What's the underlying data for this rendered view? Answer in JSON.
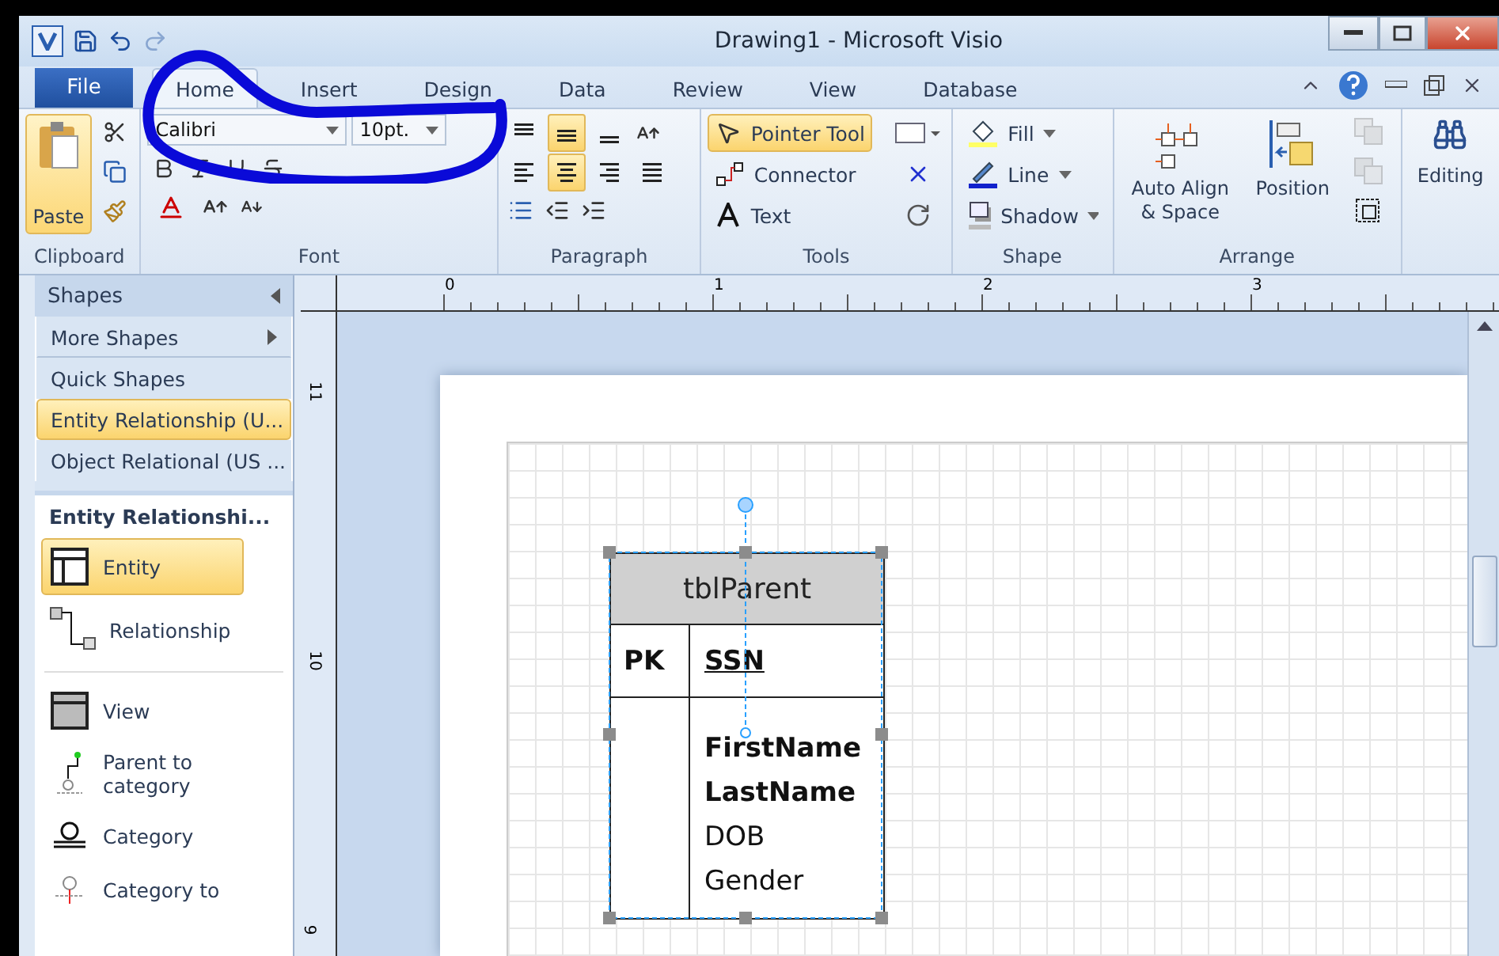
{
  "window": {
    "title": "Drawing1  -  Microsoft Visio"
  },
  "file_tab": "File",
  "tabs": [
    {
      "label": "Home",
      "selected": true
    },
    {
      "label": "Insert",
      "selected": false
    },
    {
      "label": "Design",
      "selected": false
    },
    {
      "label": "Data",
      "selected": false
    },
    {
      "label": "Review",
      "selected": false
    },
    {
      "label": "View",
      "selected": false
    },
    {
      "label": "Database",
      "selected": false
    }
  ],
  "ribbon": {
    "clipboard": {
      "paste": "Paste",
      "label": "Clipboard"
    },
    "font": {
      "font_name": "Calibri",
      "font_size": "10pt.",
      "label": "Font"
    },
    "paragraph": {
      "label": "Paragraph",
      "vertical_align": [
        {
          "selected": false
        },
        {
          "selected": true
        },
        {
          "selected": false
        }
      ],
      "horizontal_align": [
        {
          "selected": false
        },
        {
          "selected": true
        },
        {
          "selected": false
        },
        {
          "selected": false
        }
      ]
    },
    "tools": {
      "label": "Tools",
      "items": [
        {
          "kind": "pointer",
          "label": "Pointer Tool",
          "selected": true
        },
        {
          "kind": "connector",
          "label": "Connector",
          "selected": false
        },
        {
          "kind": "text",
          "label": "Text",
          "selected": false
        }
      ]
    },
    "shape": {
      "label": "Shape",
      "items": [
        {
          "kind": "fill",
          "label": "Fill"
        },
        {
          "kind": "line",
          "label": "Line"
        },
        {
          "kind": "shadow",
          "label": "Shadow"
        }
      ]
    },
    "arrange": {
      "label": "Arrange",
      "auto_align": "Auto Align & Space",
      "position": "Position"
    },
    "editing": {
      "label": "Editing"
    }
  },
  "shapes_panel": {
    "title": "Shapes",
    "items": [
      {
        "kind": "menu",
        "label": "More Shapes",
        "selected": false
      },
      {
        "kind": "stencil",
        "label": "Quick Shapes",
        "selected": false
      },
      {
        "kind": "stencil",
        "label": "Entity Relationship (U...",
        "selected": true
      },
      {
        "kind": "stencil",
        "label": "Object Relational (US ...",
        "selected": false
      }
    ],
    "stencil_title": "Entity Relationshi...",
    "masters": [
      {
        "kind": "entity",
        "label": "Entity",
        "selected": true
      },
      {
        "kind": "relationship",
        "label": "Relationship",
        "selected": false
      },
      {
        "kind": "view",
        "label": "View",
        "selected": false
      },
      {
        "kind": "parent-to-category",
        "label": "Parent to category",
        "selected": false
      },
      {
        "kind": "category",
        "label": "Category",
        "selected": false
      },
      {
        "kind": "category-to",
        "label": "Category to",
        "selected": false
      }
    ]
  },
  "ruler": {
    "top_labels": [
      "0",
      "1",
      "2",
      "3"
    ],
    "left_labels": [
      "11",
      "10",
      "9"
    ]
  },
  "entity": {
    "name": "tblParent",
    "keys": [
      {
        "tag": "PK",
        "field": "SSN"
      }
    ],
    "attributes": [
      {
        "name": "FirstName",
        "bold": true
      },
      {
        "name": "LastName",
        "bold": true
      },
      {
        "name": "DOB",
        "bold": false
      },
      {
        "name": "Gender",
        "bold": false
      }
    ]
  }
}
